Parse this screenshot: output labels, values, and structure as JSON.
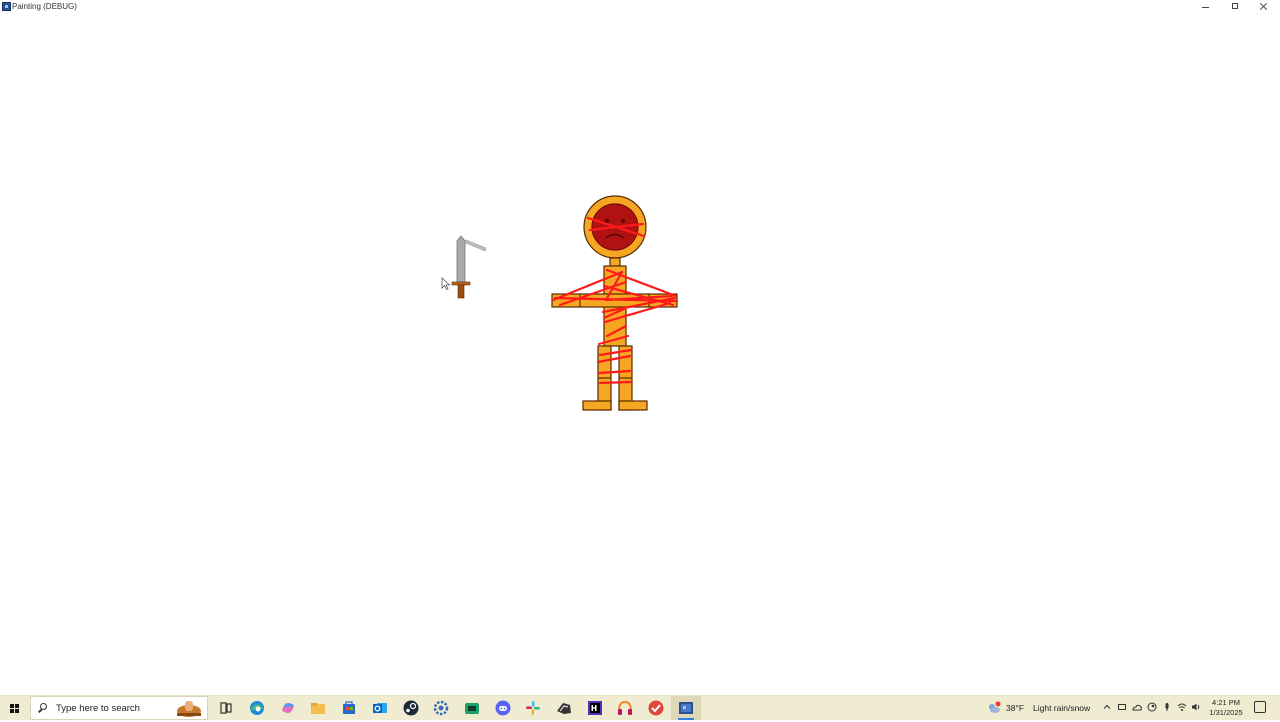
{
  "window": {
    "title": "Painting (DEBUG)",
    "controls": {
      "minimize": "minimize",
      "maximize": "restore",
      "close": "close"
    }
  },
  "taskbar": {
    "search_placeholder": "Type here to search",
    "apps": [
      "task-view-icon",
      "edge-icon",
      "copilot-icon",
      "file-explorer-icon",
      "store-icon",
      "outlook-icon",
      "steam-icon",
      "settings-app-icon",
      "terminal-icon",
      "discord-icon",
      "slack-icon",
      "unity-icon",
      "rider-icon",
      "headphones-app-icon",
      "todo-app-icon",
      "painting-app-icon"
    ],
    "weather": {
      "temp": "38°F",
      "condition": "Light rain/snow"
    },
    "clock": {
      "time": "4:21 PM",
      "date": "1/31/2025"
    }
  },
  "colors": {
    "body_fill": "#f5a623",
    "body_stroke": "#5a2a00",
    "face_fill": "#b01212",
    "scribble": "#ff1a1a",
    "blade": "#a9a9a9",
    "hilt": "#b5651d",
    "taskbar_bg": "#efecd2",
    "accent": "#3b7be0"
  }
}
